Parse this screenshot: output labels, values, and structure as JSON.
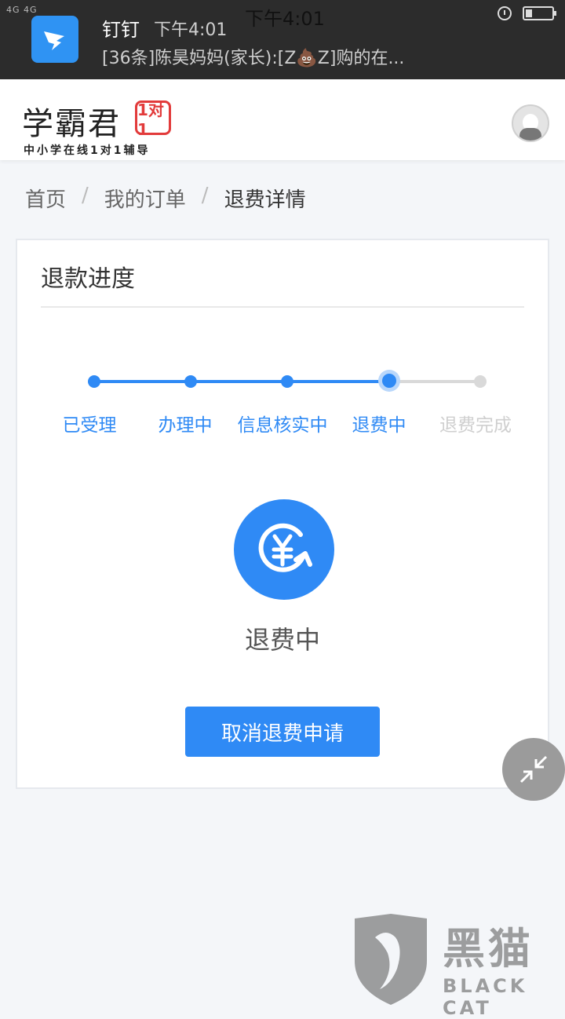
{
  "status_bar": {
    "signal": "4G 4G",
    "time": "下午4:01"
  },
  "notification": {
    "app": "钉钉",
    "time": "下午4:01",
    "message": "[36条]陈昊妈妈(家长):[Z💩Z]购的在..."
  },
  "header": {
    "brand": "学霸君",
    "badge": "1对1",
    "tagline": "中小学在线1对1辅导"
  },
  "breadcrumb": {
    "items": [
      "首页",
      "我的订单",
      "退费详情"
    ],
    "separator": "/"
  },
  "card": {
    "title": "退款进度",
    "steps": [
      {
        "label": "已受理",
        "state": "done"
      },
      {
        "label": "办理中",
        "state": "done"
      },
      {
        "label": "信息核实中",
        "state": "done"
      },
      {
        "label": "退费中",
        "state": "active"
      },
      {
        "label": "退费完成",
        "state": "pending"
      }
    ],
    "status_text": "退费中",
    "cancel_button": "取消退费申请"
  },
  "watermark": {
    "title": "黑猫",
    "subtitle": "BLACK CAT"
  },
  "colors": {
    "accent": "#2f8af5",
    "badge_red": "#e23b3b",
    "pending": "#d9d9d9"
  }
}
